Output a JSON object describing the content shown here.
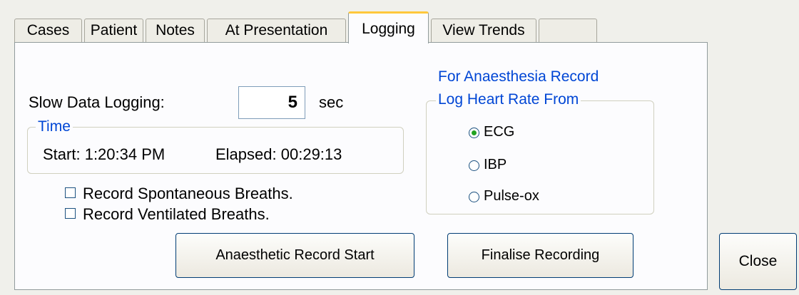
{
  "tabs": [
    {
      "label": "Cases"
    },
    {
      "label": "Patient"
    },
    {
      "label": "Notes"
    },
    {
      "label": "At Presentation"
    },
    {
      "label": "Logging"
    },
    {
      "label": "View Trends"
    },
    {
      "label": ""
    }
  ],
  "active_tab": "Logging",
  "logging": {
    "slow_label": "Slow Data Logging:",
    "slow_value": "5",
    "slow_unit": "sec",
    "time_group": "Time",
    "start_label": "Start:",
    "start_value": "1:20:34 PM",
    "elapsed_label": "Elapsed:",
    "elapsed_value": "00:29:13",
    "spontaneous_label": "Record Spontaneous Breaths.",
    "spontaneous_checked": false,
    "ventilated_label": "Record Ventilated Breaths.",
    "ventilated_checked": false
  },
  "anaesthesia": {
    "heading": "For Anaesthesia Record",
    "group": "Log Heart Rate From",
    "options": [
      "ECG",
      "IBP",
      "Pulse-ox"
    ],
    "selected": "ECG"
  },
  "buttons": {
    "start": "Anaesthetic Record Start",
    "finalise": "Finalise Recording",
    "close": "Close"
  },
  "colors": {
    "group_title": "#0046d5",
    "tab_highlight": "#ffc83c",
    "radio_selected": "#22a321"
  }
}
